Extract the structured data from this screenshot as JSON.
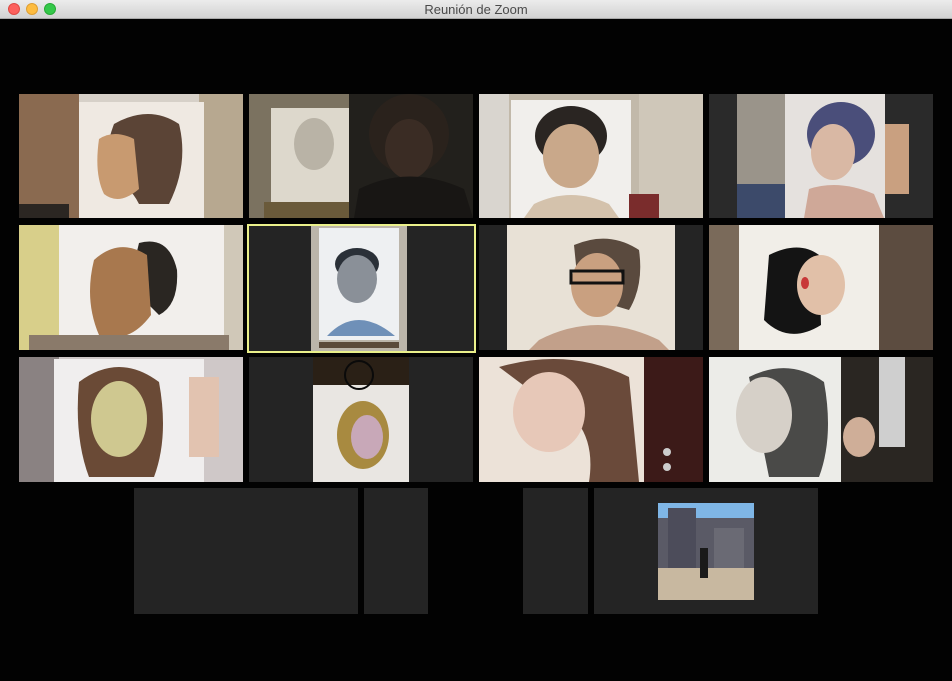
{
  "window": {
    "title": "Reunión de Zoom",
    "controls": [
      "close",
      "minimize",
      "zoom"
    ],
    "colors": {
      "close": "#fc605c",
      "minimize": "#fdbc40",
      "zoom": "#34c84a"
    }
  },
  "gallery": {
    "active_speaker_highlight": "#e3e87a",
    "participants": [
      {
        "id": "p1",
        "video": "profile-portrait-drawing"
      },
      {
        "id": "p2",
        "video": "person-with-easel-drawing"
      },
      {
        "id": "p3",
        "video": "woman-portrait-drawing"
      },
      {
        "id": "p4",
        "video": "purple-hair-portrait-drawing"
      },
      {
        "id": "p5",
        "video": "dark-hair-profile-drawing"
      },
      {
        "id": "p6",
        "video": "man-portrait-drawing",
        "active": true
      },
      {
        "id": "p7",
        "video": "woman-with-glasses-drawing"
      },
      {
        "id": "p8",
        "video": "ponytail-profile-drawing"
      },
      {
        "id": "p9",
        "video": "curly-hair-portrait-drawing"
      },
      {
        "id": "p10",
        "video": "yellow-face-portrait-drawing"
      },
      {
        "id": "p11",
        "video": "long-hair-portrait-drawing"
      },
      {
        "id": "p12",
        "video": "pencil-portrait-drawing"
      },
      {
        "id": "p13",
        "video": "camera-off"
      },
      {
        "id": "p14",
        "video": "camera-off"
      },
      {
        "id": "p15",
        "video": "camera-off"
      },
      {
        "id": "p16",
        "video": "profile-photo-castle"
      }
    ]
  }
}
